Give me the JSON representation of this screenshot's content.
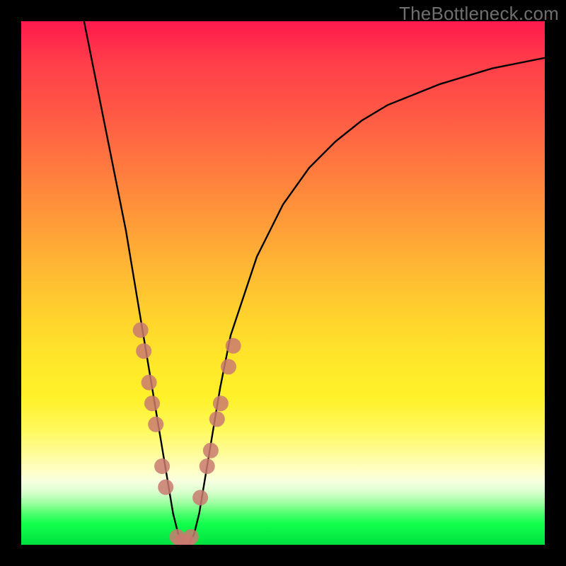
{
  "watermark_text": "TheBottleneck.com",
  "chart_data": {
    "type": "line",
    "title": "",
    "xlabel": "",
    "ylabel": "",
    "xlim": [
      0,
      100
    ],
    "ylim": [
      0,
      100
    ],
    "series": [
      {
        "name": "bottleneck-curve",
        "x": [
          12,
          14,
          16,
          18,
          20,
          22,
          23,
          24,
          25,
          26,
          27,
          28,
          29,
          30,
          31,
          32,
          33,
          34,
          35,
          36,
          38,
          40,
          45,
          50,
          55,
          60,
          65,
          70,
          80,
          90,
          100
        ],
        "y": [
          100,
          90,
          80,
          70,
          60,
          48,
          42,
          36,
          30,
          24,
          18,
          12,
          6,
          2,
          0,
          0,
          2,
          6,
          12,
          18,
          30,
          40,
          55,
          65,
          72,
          77,
          81,
          84,
          88,
          91,
          93
        ]
      }
    ],
    "beads": {
      "name": "data-point-beads",
      "points": [
        {
          "x": 22.8,
          "y": 41
        },
        {
          "x": 23.4,
          "y": 37
        },
        {
          "x": 24.4,
          "y": 31
        },
        {
          "x": 25.0,
          "y": 27
        },
        {
          "x": 25.7,
          "y": 23
        },
        {
          "x": 26.9,
          "y": 15
        },
        {
          "x": 27.6,
          "y": 11
        },
        {
          "x": 29.8,
          "y": 1.5
        },
        {
          "x": 30.6,
          "y": 0.6
        },
        {
          "x": 31.6,
          "y": 0.6
        },
        {
          "x": 32.4,
          "y": 1.5
        },
        {
          "x": 34.2,
          "y": 9
        },
        {
          "x": 35.5,
          "y": 15
        },
        {
          "x": 36.2,
          "y": 18
        },
        {
          "x": 37.4,
          "y": 24
        },
        {
          "x": 38.1,
          "y": 27
        },
        {
          "x": 39.6,
          "y": 34
        },
        {
          "x": 40.5,
          "y": 38
        }
      ],
      "radius": 11
    },
    "gradient_stops": [
      {
        "pos": 0,
        "color": "#ff1a4d"
      },
      {
        "pos": 50,
        "color": "#ffba33"
      },
      {
        "pos": 75,
        "color": "#fff12a"
      },
      {
        "pos": 100,
        "color": "#00e040"
      }
    ]
  }
}
